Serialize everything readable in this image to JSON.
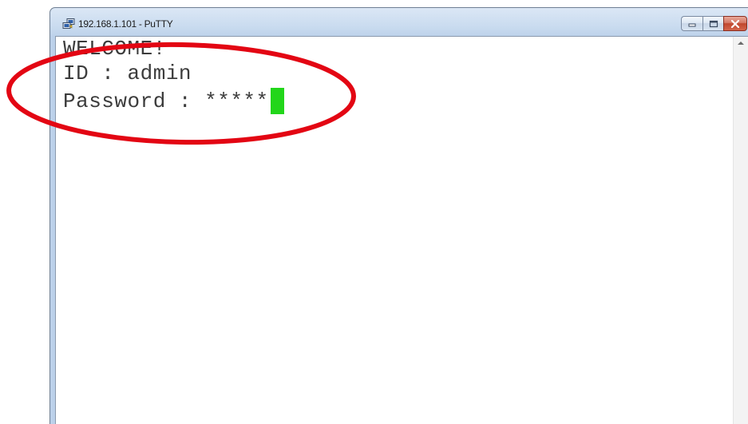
{
  "window": {
    "title": "192.168.1.101 - PuTTY",
    "icon": "putty-icon"
  },
  "caption_buttons": {
    "minimize_icon": "minimize-icon",
    "maximize_icon": "maximize-icon",
    "close_icon": "close-icon"
  },
  "terminal": {
    "lines": [
      "WELCOME!",
      "ID : admin",
      "Password : *****"
    ],
    "cursor_color": "#22d61a",
    "text_color": "#3c3c3c"
  },
  "annotation": {
    "shape": "ellipse",
    "color": "#e30613"
  }
}
